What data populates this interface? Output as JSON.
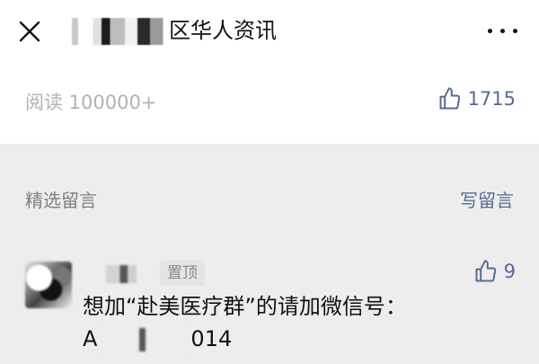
{
  "header": {
    "title_suffix": "区华人资讯",
    "close_icon": "close-icon",
    "more_icon": "more-icon"
  },
  "stats": {
    "reads": "阅读 100000+",
    "likes": "1715"
  },
  "comments": {
    "title": "精选留言",
    "write": "写留言",
    "items": [
      {
        "pin": "置顶",
        "likes": "9",
        "text_line1": "想加“赴美医疗群”的请加微信号：",
        "text_prefix": "A",
        "text_suffix": "014"
      }
    ]
  },
  "colors": {
    "link": "#576b95",
    "muted": "#b2b2b2",
    "background": "#ededed"
  }
}
